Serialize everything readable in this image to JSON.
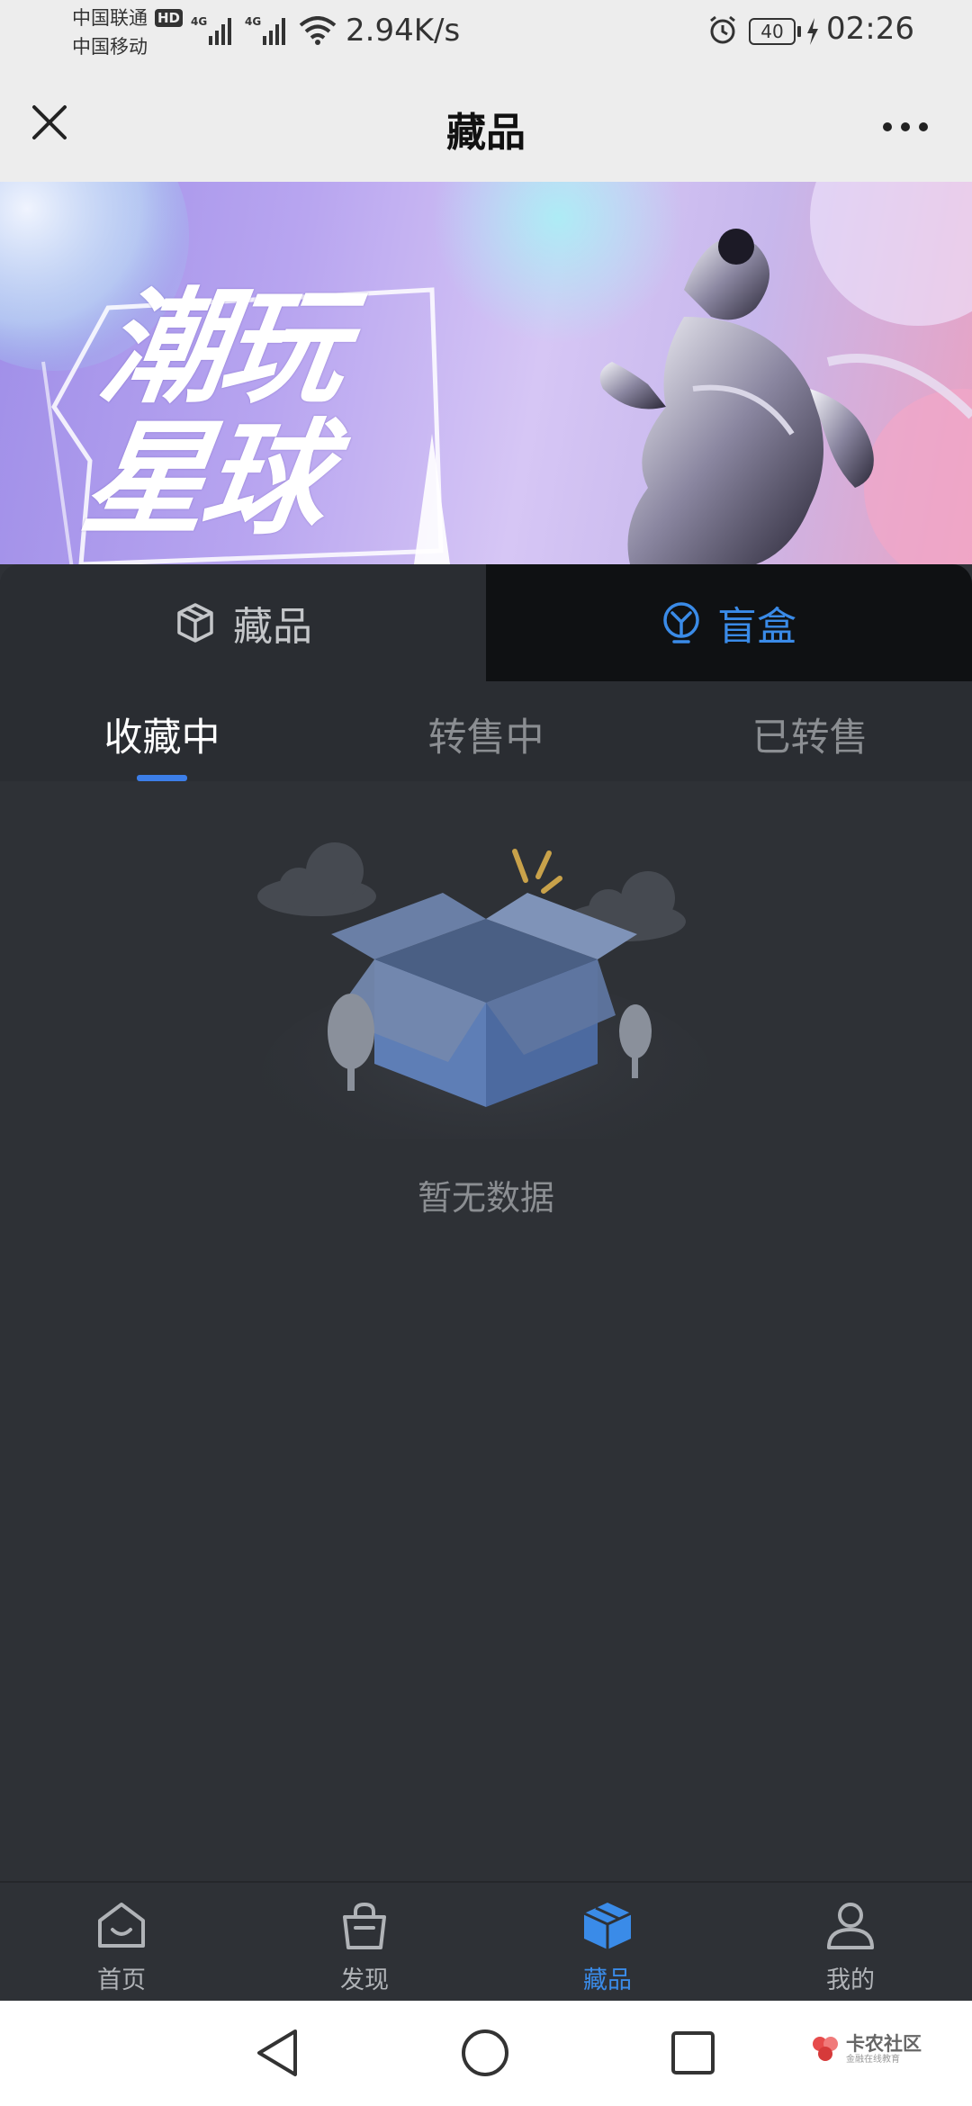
{
  "status_bar": {
    "carrier1": "中国联通",
    "carrier2": "中国移动",
    "hd_badge": "HD",
    "net_type1": "4G",
    "net_type2": "4G",
    "net_speed": "2.94K/s",
    "battery": "40",
    "time": "02:26"
  },
  "titlebar": {
    "title": "藏品"
  },
  "banner": {
    "title_line1": "潮玩",
    "title_line2": "星球"
  },
  "category_tabs": [
    {
      "label": "藏品",
      "icon": "cube-icon",
      "active": false
    },
    {
      "label": "盲盒",
      "icon": "blind-box-icon",
      "active": true
    }
  ],
  "sub_tabs": [
    {
      "label": "收藏中",
      "active": true
    },
    {
      "label": "转售中",
      "active": false
    },
    {
      "label": "已转售",
      "active": false
    }
  ],
  "empty_state": {
    "text": "暂无数据"
  },
  "bottom_nav": [
    {
      "label": "首页",
      "icon": "home-icon",
      "active": false
    },
    {
      "label": "发现",
      "icon": "bag-icon",
      "active": false
    },
    {
      "label": "藏品",
      "icon": "collection-box-icon",
      "active": true
    },
    {
      "label": "我的",
      "icon": "user-icon",
      "active": false
    }
  ],
  "watermark": {
    "main": "卡农社区",
    "sub": "金融在线教育"
  },
  "colors": {
    "accent": "#3a8be8",
    "page_bg": "#2e3136",
    "tab_bg": "#2a2d32",
    "active_tab_bg": "#0f1113"
  }
}
